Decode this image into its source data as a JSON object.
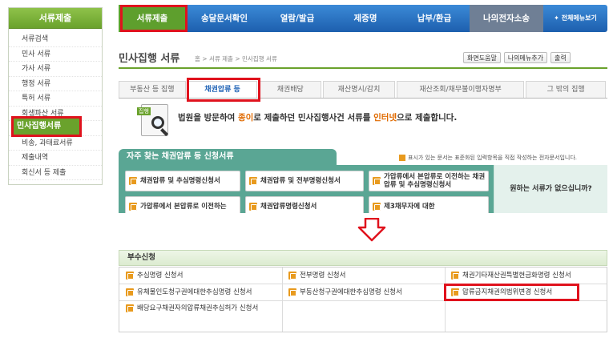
{
  "sidebar": {
    "title": "서류제출",
    "items": [
      {
        "label": "서류검색"
      },
      {
        "label": "민사 서류"
      },
      {
        "label": "가사 서류"
      },
      {
        "label": "행정 서류"
      },
      {
        "label": "특허 서류"
      },
      {
        "label": "회생파산 서류"
      },
      {
        "label": "민사집행서류"
      },
      {
        "label": "비송, 과태료서류"
      },
      {
        "label": "제출내역"
      },
      {
        "label": "회신서 등 제출"
      }
    ]
  },
  "nav": {
    "items": [
      {
        "label": "서류제출"
      },
      {
        "label": "송달문서확인"
      },
      {
        "label": "열람/발급"
      },
      {
        "label": "제증명"
      },
      {
        "label": "납부/환급"
      },
      {
        "label": "나의전자소송"
      },
      {
        "label": "✦ 전체메뉴보기"
      }
    ]
  },
  "page": {
    "title": "민사집행 서류",
    "breadcrumb": "홈 > 서류 제출 > 민사집행 서류",
    "tools": [
      "화면도움말",
      "나의메뉴추가",
      "출력"
    ]
  },
  "subtabs": [
    "부동산 등 집행",
    "채권압류 등",
    "채권배당",
    "재산명시/감치",
    "재산조회/채무불이행자명부",
    "그 밖의 집행"
  ],
  "notice": {
    "icon_label": "집행",
    "text_a": "법원을 방문하여 ",
    "text_b": "종이",
    "text_c": "로 제출하던 민사집행사건 서류를 ",
    "text_d": "인터넷",
    "text_e": "으로 제출합니다."
  },
  "quick": {
    "title": "자주 찾는 채권압류 등 신청서류",
    "note": "표시가 있는 문서는 표준화된 입력항목을 직접 작성하는 전자문서입니다.",
    "buttons": [
      "채권압류 및 추심명령신청서",
      "채권압류 및 전부명령신청서",
      "가압류에서 본압류로 이전하는 채권압류 및 추심명령신청서",
      "가압류에서 본압류로 이전하는",
      "채권압류명령신청서",
      "제3채무자에 대한"
    ],
    "side_text": "원하는 서류가 없으십니까?"
  },
  "attached": {
    "title": "부수신청",
    "rows": [
      [
        "추심명령 신청서",
        "전부명령 신청서",
        "채권기타재산권특별현금화명령 신청서"
      ],
      [
        "유체물인도청구권에대한추심명령 신청서",
        "부동산청구권에대한추심명령 신청서",
        "압류금지채권의범위변경 신청서"
      ],
      [
        "배당요구채권자의압류채권추심허가 신청서",
        "",
        ""
      ]
    ]
  },
  "colors": {
    "accent_green": "#6aa22c",
    "nav_blue": "#2b6cbd",
    "quick_teal": "#5aa694",
    "highlight_red": "#e0121d",
    "doc_icon_orange": "#e89a1e"
  }
}
